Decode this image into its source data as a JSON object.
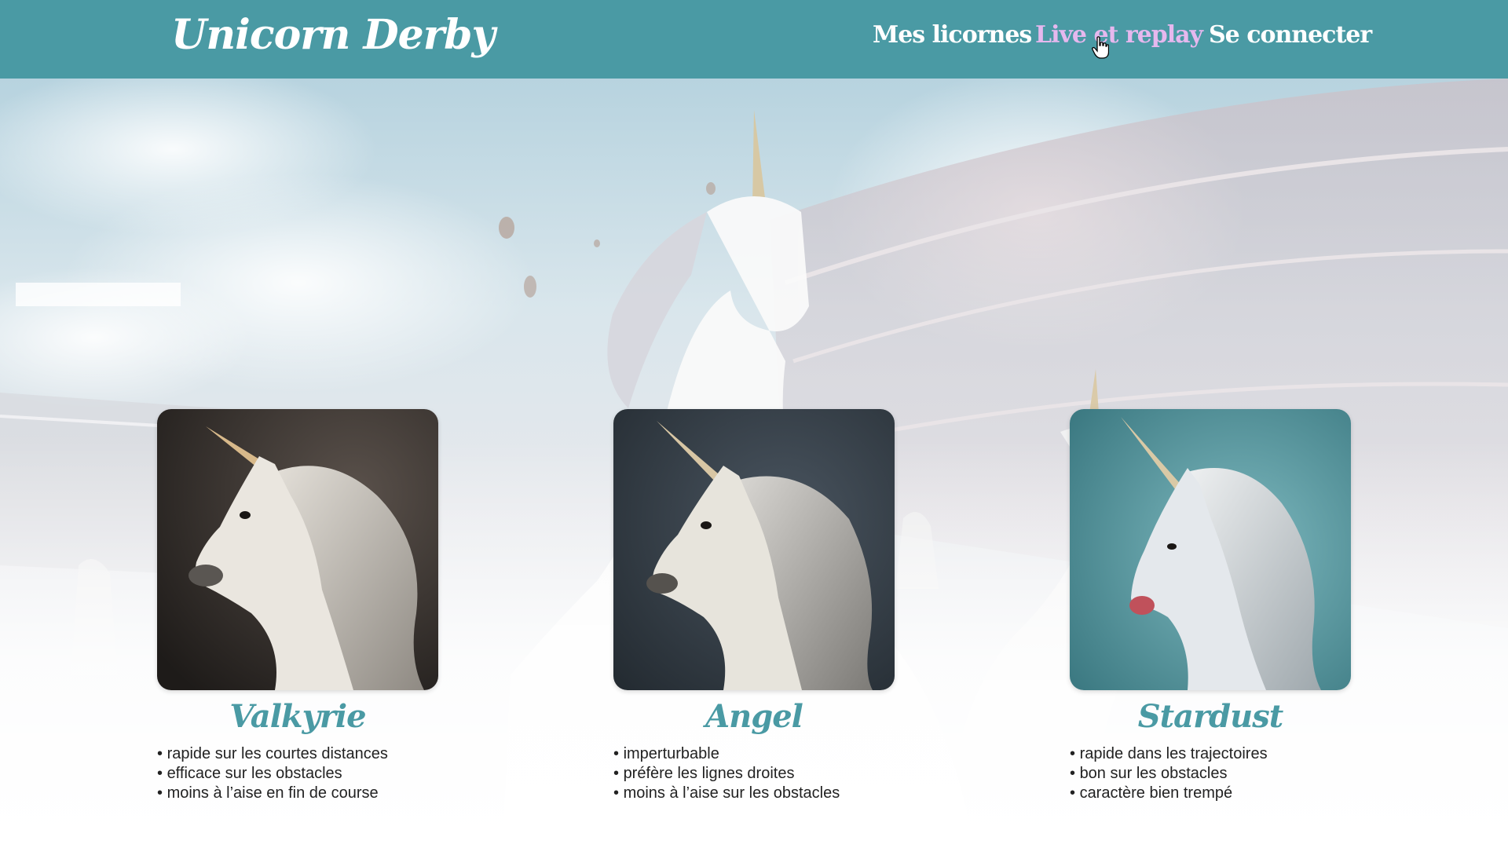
{
  "header": {
    "brand": "Unicorn Derby",
    "nav": [
      {
        "label": "Mes licornes",
        "active": false
      },
      {
        "label": "Live et replay",
        "active": true
      },
      {
        "label": "Se connecter",
        "active": false
      }
    ],
    "accent_color": "#4a9aa4",
    "active_color": "#e6b8ee"
  },
  "cards": [
    {
      "name": "Valkyrie",
      "traits": [
        "rapide sur les courtes distances",
        "efficace sur les obstacles",
        "moins à l’aise en fin de course"
      ]
    },
    {
      "name": "Angel",
      "traits": [
        "imperturbable",
        "préfère les lignes droites",
        "moins à l’aise sur les obstacles"
      ]
    },
    {
      "name": "Stardust",
      "traits": [
        "rapide dans les trajectoires",
        "bon sur les obstacles",
        "caractère bien trempé"
      ]
    }
  ],
  "icons": {
    "cursor": "hand-pointer-icon"
  }
}
